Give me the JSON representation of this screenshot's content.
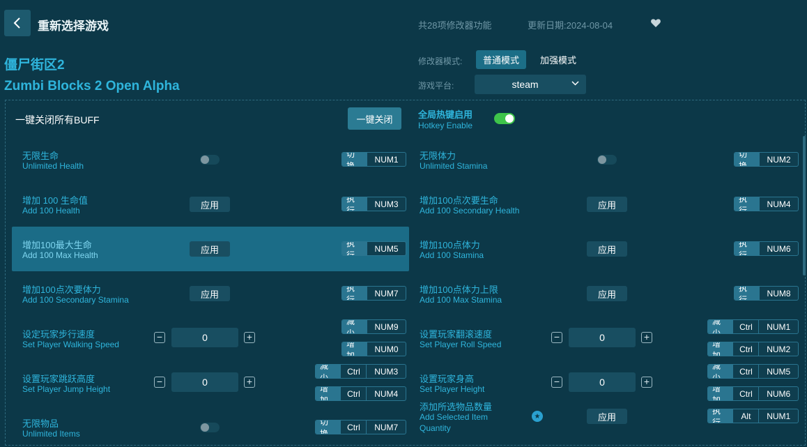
{
  "header": {
    "title": "重新选择游戏",
    "feature_count": "共28项修改器功能",
    "update_date": "更新日期:2024-08-04"
  },
  "game": {
    "name_cn": "僵尸街区2",
    "name_en": "Zumbi Blocks 2 Open Alpha"
  },
  "mode": {
    "label": "修改器模式:",
    "normal": "普通模式",
    "enhanced": "加强模式",
    "selected": "普通模式"
  },
  "platform": {
    "label": "游戏平台:",
    "value": "steam"
  },
  "controls": {
    "close_all_label": "一键关闭所有BUFF",
    "close_all_button": "一键关闭",
    "hotkey_cn": "全局热键启用",
    "hotkey_en": "Hotkey Enable",
    "hotkey_enabled": true
  },
  "apply_label": "应用",
  "cheats": [
    {
      "cn": "无限生命",
      "en": "Unlimited Health",
      "type": "toggle",
      "act": "切换",
      "keys": [
        "NUM1"
      ]
    },
    {
      "cn": "无限体力",
      "en": "Unlimited Stamina",
      "type": "toggle",
      "act": "切换",
      "keys": [
        "NUM2"
      ]
    },
    {
      "cn": "增加 100 生命值",
      "en": "Add 100 Health",
      "type": "apply",
      "act": "执行",
      "keys": [
        "NUM3"
      ]
    },
    {
      "cn": "增加100点次要生命",
      "en": "Add 100 Secondary Health",
      "type": "apply",
      "act": "执行",
      "keys": [
        "NUM4"
      ]
    },
    {
      "cn": "增加100最大生命",
      "en": "Add 100 Max Health",
      "type": "apply",
      "act": "执行",
      "keys": [
        "NUM5"
      ],
      "highlighted": true
    },
    {
      "cn": "增加100点体力",
      "en": "Add 100 Stamina",
      "type": "apply",
      "act": "执行",
      "keys": [
        "NUM6"
      ]
    },
    {
      "cn": "增加100点次要体力",
      "en": "Add 100 Secondary Stamina",
      "type": "apply",
      "act": "执行",
      "keys": [
        "NUM7"
      ]
    },
    {
      "cn": "增加100点体力上限",
      "en": "Add 100 Max Stamina",
      "type": "apply",
      "act": "执行",
      "keys": [
        "NUM8"
      ]
    },
    {
      "cn": "设定玩家步行速度",
      "en": "Set Player Walking Speed",
      "type": "stepper",
      "value": "0",
      "dec": {
        "act": "减少",
        "keys": [
          "NUM9"
        ]
      },
      "inc": {
        "act": "增加",
        "keys": [
          "NUM0"
        ]
      }
    },
    {
      "cn": "设置玩家翻滚速度",
      "en": "Set Player Roll Speed",
      "type": "stepper",
      "value": "0",
      "dec": {
        "act": "减少",
        "keys": [
          "Ctrl",
          "NUM1"
        ]
      },
      "inc": {
        "act": "增加",
        "keys": [
          "Ctrl",
          "NUM2"
        ]
      }
    },
    {
      "cn": "设置玩家跳跃高度",
      "en": "Set Player Jump Height",
      "type": "stepper",
      "value": "0",
      "dec": {
        "act": "减少",
        "keys": [
          "Ctrl",
          "NUM3"
        ]
      },
      "inc": {
        "act": "增加",
        "keys": [
          "Ctrl",
          "NUM4"
        ]
      }
    },
    {
      "cn": "设置玩家身高",
      "en": "Set Player Height",
      "type": "stepper",
      "value": "0",
      "dec": {
        "act": "减少",
        "keys": [
          "Ctrl",
          "NUM5"
        ]
      },
      "inc": {
        "act": "增加",
        "keys": [
          "Ctrl",
          "NUM6"
        ]
      }
    },
    {
      "cn": "无限物品",
      "en": "Unlimited Items",
      "type": "toggle",
      "act": "切换",
      "keys": [
        "Ctrl",
        "NUM7"
      ]
    },
    {
      "cn": "添加所选物品数量",
      "en": "Add Selected Item",
      "en2": "Quantity",
      "type": "apply",
      "star": true,
      "act": "执行",
      "keys": [
        "Alt",
        "NUM1"
      ]
    }
  ],
  "colors": {
    "background": "#0c3848",
    "accent": "#2fb5dc",
    "highlight_row": "#1b6c87",
    "toggle_on": "#3ec44a"
  }
}
